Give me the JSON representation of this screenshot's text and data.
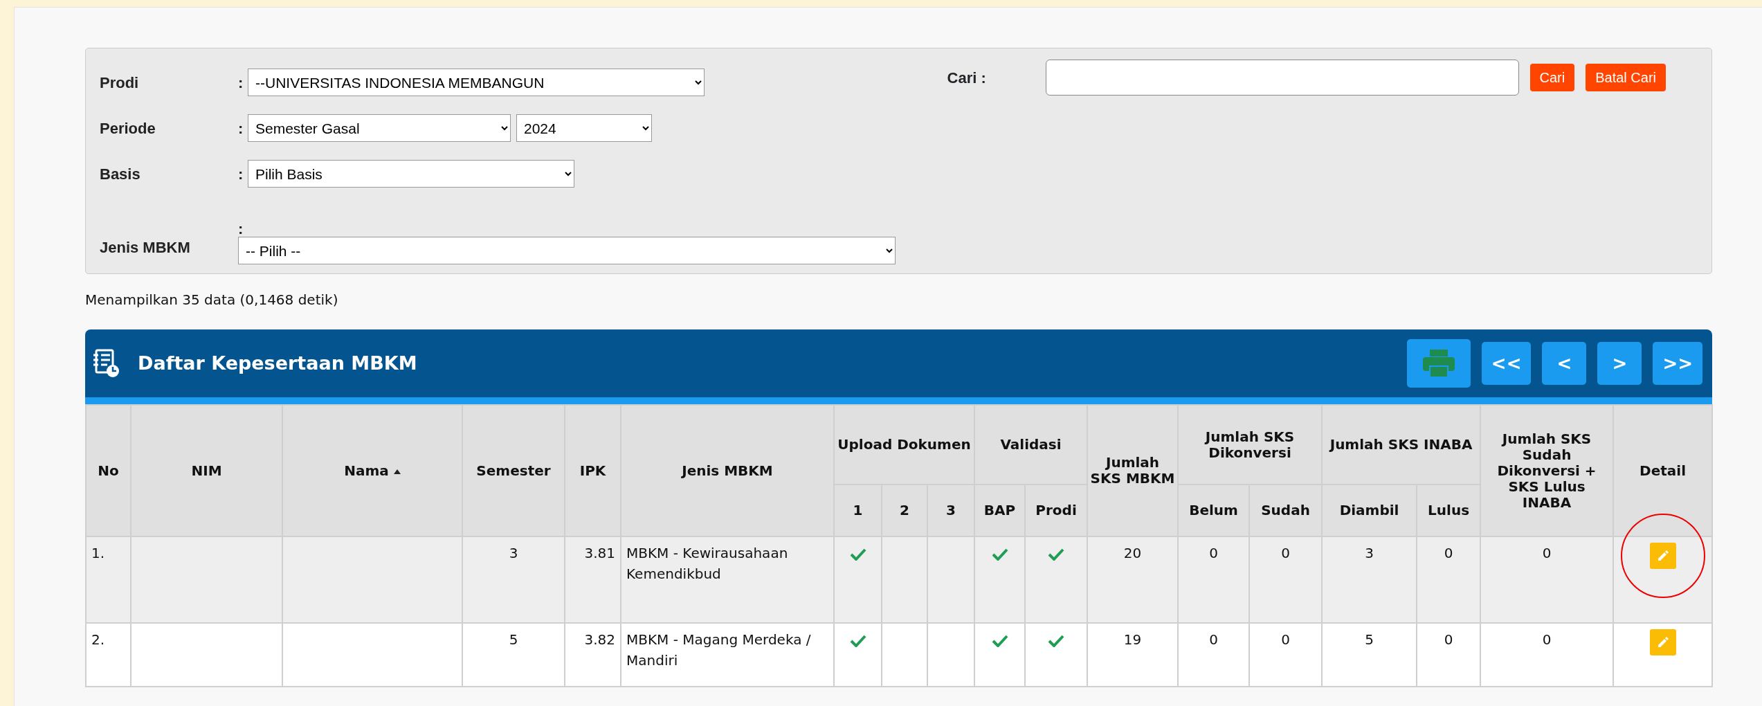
{
  "filters": [
    {
      "label": "Prodi",
      "colon": ":",
      "kind": "inline",
      "values": [
        "--UNIVERSITAS INDONESIA MEMBANGUN"
      ]
    },
    {
      "label": "Periode",
      "colon": ":",
      "kind": "inline",
      "values": [
        "Semester Gasal",
        "2024"
      ]
    },
    {
      "label": "Basis",
      "colon": ":",
      "kind": "inline",
      "values": [
        "Pilih Basis"
      ]
    },
    {
      "label": "Jenis MBKM",
      "colon": ":",
      "kind": "stacked",
      "values": [
        "-- Pilih --"
      ]
    }
  ],
  "search": {
    "label": "Cari :",
    "buttons": [
      "Cari",
      "Batal Cari"
    ]
  },
  "status": "Menampilkan 35 data (0,1468 detik)",
  "table": {
    "title": "Daftar Kepesertaan MBKM",
    "pager": [
      "<<",
      "<",
      ">",
      ">>"
    ],
    "columns": [
      {
        "label": "No",
        "sorted": false
      },
      {
        "label": "NIM",
        "sorted": false
      },
      {
        "label": "Nama",
        "sorted": true
      },
      {
        "label": "Semester",
        "sorted": false
      },
      {
        "label": "IPK",
        "sorted": false
      },
      {
        "label": "Jenis MBKM",
        "sorted": false
      },
      {
        "label": "Upload Dokumen",
        "children": [
          "1",
          "2",
          "3"
        ]
      },
      {
        "label": "Validasi",
        "children": [
          "BAP",
          "Prodi"
        ]
      },
      {
        "label": "Jumlah SKS MBKM",
        "sorted": false
      },
      {
        "label": "Jumlah SKS Dikonversi",
        "children": [
          "Belum",
          "Sudah"
        ]
      },
      {
        "label": "Jumlah SKS INABA",
        "children": [
          "Diambil",
          "Lulus"
        ]
      },
      {
        "label": "Jumlah SKS Sudah Dikonversi + SKS Lulus INABA",
        "sorted": false
      },
      {
        "label": "Detail",
        "sorted": false
      }
    ],
    "rows": [
      {
        "no": "1.",
        "semester": "3",
        "ipk": "3.81",
        "jenis": "MBKM - Kewirausahaan Kemendikbud",
        "upload": [
          true,
          false,
          false
        ],
        "validasi": [
          true,
          true
        ],
        "sks_mbkm": "20",
        "dikonversi": [
          "0",
          "0"
        ],
        "inaba": [
          "3",
          "0"
        ],
        "total": "0",
        "highlighted": true
      },
      {
        "no": "2.",
        "semester": "5",
        "ipk": "3.82",
        "jenis": "MBKM - Magang Merdeka / Mandiri",
        "upload": [
          true,
          false,
          false
        ],
        "validasi": [
          true,
          true
        ],
        "sks_mbkm": "19",
        "dikonversi": [
          "0",
          "0"
        ],
        "inaba": [
          "5",
          "0"
        ],
        "total": "0",
        "highlighted": false
      }
    ]
  }
}
